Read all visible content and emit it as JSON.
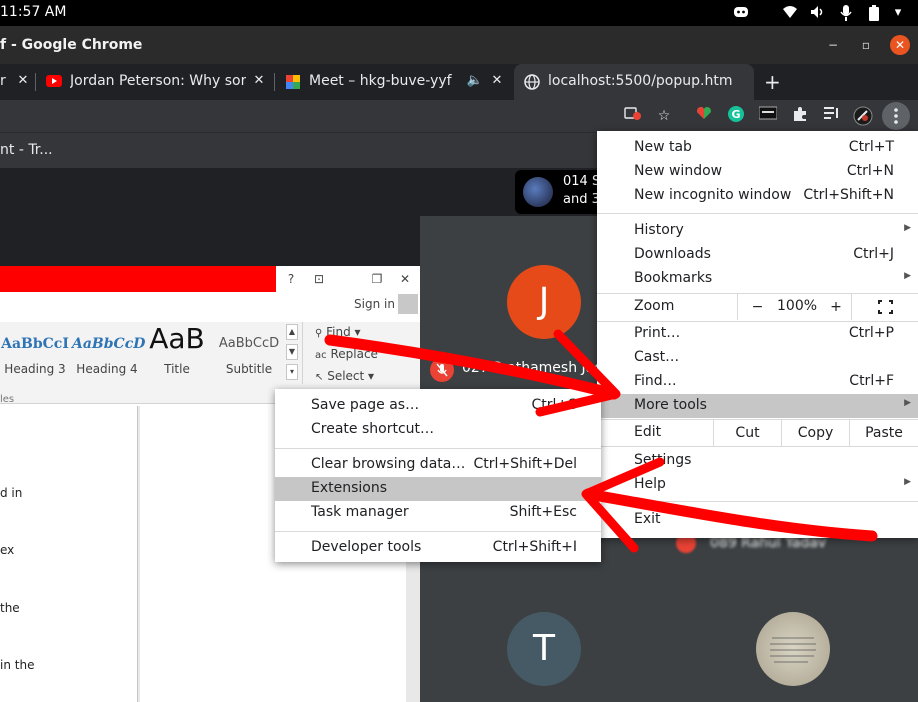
{
  "system_bar": {
    "time": "11:57 AM",
    "icons": [
      "discord-icon",
      "wifi-icon",
      "volume-icon",
      "microphone-icon",
      "battery-icon",
      "chevron-down-icon"
    ]
  },
  "window": {
    "title": "f - Google Chrome",
    "controls": {
      "minimize": "−",
      "maximize": "▫",
      "close": "✕"
    }
  },
  "tabs": [
    {
      "label": "r",
      "icon": "",
      "close": "✕"
    },
    {
      "label": "Jordan Peterson: Why sor",
      "icon": "youtube-icon",
      "close": "✕"
    },
    {
      "label": "Meet – hkg-buve-yyf",
      "icon": "meet-icon",
      "close": "✕",
      "audio": "🔈"
    },
    {
      "label": "localhost:5500/popup.htm",
      "icon": "globe-icon",
      "close": ""
    }
  ],
  "new_tab_label": "+",
  "bookmark_bar": {
    "item": "nt - Tr..."
  },
  "meet": {
    "notification": {
      "line1": "014 S",
      "line2": "and 3"
    },
    "participant_j": {
      "initial": "J",
      "name": "027 Prathamesh Jadh"
    },
    "participant_blurred": {
      "name": "089 Rahul Yadav"
    },
    "participant_t": {
      "initial": "T"
    }
  },
  "word": {
    "controls": [
      "?",
      "⊡",
      "❐",
      "✕"
    ],
    "sign_in": "Sign in",
    "styles": [
      {
        "sample": "AaBbCcI",
        "name": "Heading 3"
      },
      {
        "sample": "AaBbCcD",
        "name": "Heading 4"
      },
      {
        "sample": "AaB",
        "name": "Title"
      },
      {
        "sample": "AaBbCcD",
        "name": "Subtitle"
      }
    ],
    "editing": {
      "find": "Find ▾",
      "replace": "Replace",
      "select": "Select ▾"
    },
    "group_label": "les",
    "doc_lines": [
      "d in",
      "ex",
      "the",
      "in the"
    ]
  },
  "menu": {
    "items_top": [
      {
        "label": "New tab",
        "shortcut": "Ctrl+T"
      },
      {
        "label": "New window",
        "shortcut": "Ctrl+N"
      },
      {
        "label": "New incognito window",
        "shortcut": "Ctrl+Shift+N"
      }
    ],
    "items_history": [
      {
        "label": "History",
        "shortcut": ""
      },
      {
        "label": "Downloads",
        "shortcut": "Ctrl+J"
      },
      {
        "label": "Bookmarks",
        "shortcut": ""
      }
    ],
    "zoom": {
      "label": "Zoom",
      "minus": "−",
      "value": "100%",
      "plus": "+"
    },
    "items_tools": [
      {
        "label": "Print…",
        "shortcut": "Ctrl+P"
      },
      {
        "label": "Cast…",
        "shortcut": ""
      },
      {
        "label": "Find…",
        "shortcut": "Ctrl+F"
      },
      {
        "label": "More tools",
        "shortcut": ""
      }
    ],
    "edit": {
      "label": "Edit",
      "cut": "Cut",
      "copy": "Copy",
      "paste": "Paste"
    },
    "items_bottom": [
      {
        "label": "Settings",
        "shortcut": ""
      },
      {
        "label": "Help",
        "shortcut": ""
      }
    ],
    "exit": "Exit"
  },
  "more_tools": [
    {
      "label": "Save page as…",
      "shortcut": "Ctrl+S"
    },
    {
      "label": "Create shortcut…",
      "shortcut": ""
    },
    {
      "label": "Clear browsing data…",
      "shortcut": "Ctrl+Shift+Del"
    },
    {
      "label": "Extensions",
      "shortcut": ""
    },
    {
      "label": "Task manager",
      "shortcut": "Shift+Esc"
    },
    {
      "label": "Developer tools",
      "shortcut": "Ctrl+Shift+I"
    }
  ],
  "colors": {
    "annotation_red": "#ff0000",
    "meet_avatar_j": "#e64a19",
    "meet_avatar_t": "#455a64",
    "menu_highlight": "#c6c6c6"
  }
}
